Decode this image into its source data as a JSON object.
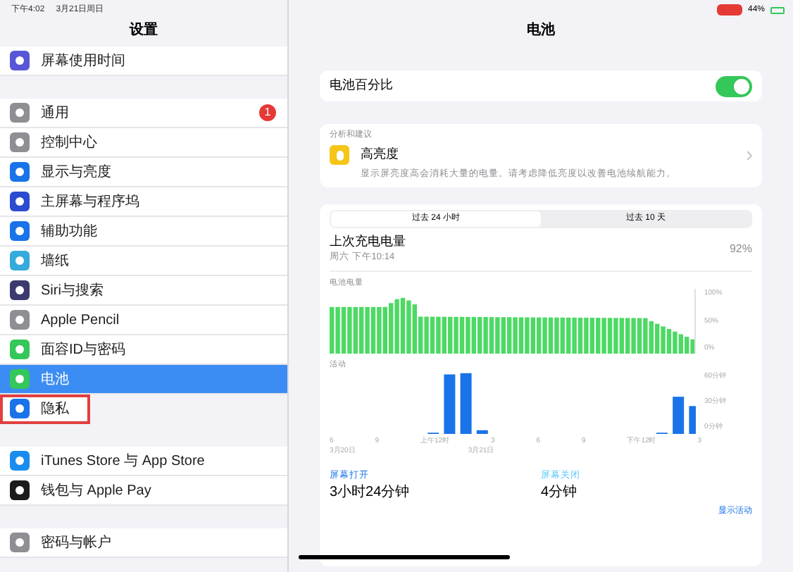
{
  "status_bar": {
    "time": "下午4:02",
    "date": "3月21日周日",
    "battery": "44%"
  },
  "sidebar": {
    "title": "设置",
    "groups": [
      [
        {
          "label": "屏幕使用时间",
          "color": "#5856d6",
          "selected": false,
          "highlighted": false
        }
      ],
      [
        {
          "label": "通用",
          "color": "#8e8e93",
          "selected": false,
          "highlighted": false,
          "badge": "1"
        },
        {
          "label": "控制中心",
          "color": "#8e8e93",
          "selected": false,
          "highlighted": false
        },
        {
          "label": "显示与亮度",
          "color": "#1a73e8",
          "selected": false,
          "highlighted": false
        },
        {
          "label": "主屏幕与程序坞",
          "color": "#2c4bd1",
          "selected": false,
          "highlighted": false
        },
        {
          "label": "辅助功能",
          "color": "#1a73e8",
          "selected": false,
          "highlighted": false
        },
        {
          "label": "墙纸",
          "color": "#35aadc",
          "selected": false,
          "highlighted": false
        },
        {
          "label": "Siri与搜索",
          "color": "#3a3a6e",
          "selected": false,
          "highlighted": false
        },
        {
          "label": "Apple Pencil",
          "color": "#8e8e93",
          "selected": false,
          "highlighted": false
        },
        {
          "label": "面容ID与密码",
          "color": "#34c759",
          "selected": false,
          "highlighted": false
        },
        {
          "label": "电池",
          "color": "#34c759",
          "selected": true,
          "highlighted": false
        },
        {
          "label": "隐私",
          "color": "#1a73e8",
          "selected": false,
          "highlighted": true
        }
      ],
      [
        {
          "label": "iTunes Store 与 App Store",
          "color": "#1a8cf0",
          "selected": false,
          "highlighted": false
        },
        {
          "label": "钱包与 Apple Pay",
          "color": "#1c1c1e",
          "selected": false,
          "highlighted": false
        }
      ],
      [
        {
          "label": "密码与帐户",
          "color": "#8e8e93",
          "selected": false,
          "highlighted": false
        }
      ]
    ]
  },
  "detail": {
    "title": "电池",
    "percentage": {
      "label": "电池百分比",
      "on": true
    },
    "insights": {
      "header": "分析和建议",
      "title": "高亮度",
      "description": "显示屏亮度高会消耗大量的电量。请考虑降低亮度以改善电池续航能力。"
    },
    "tabs": [
      {
        "label": "过去 24 小时",
        "selected": true
      },
      {
        "label": "过去 10 天",
        "selected": false
      }
    ],
    "last_charge": {
      "title": "上次充电电量",
      "time": "周六 下午10:14",
      "value": "92%"
    },
    "battery_chart": {
      "label": "电池电量",
      "yticks": [
        "100%",
        "50%",
        "0%"
      ]
    },
    "activity_chart": {
      "label": "活动",
      "yticks": [
        "60分钟",
        "30分钟",
        "0分钟"
      ],
      "xticks": [
        "6",
        "9",
        "上午12时",
        "3",
        "6",
        "9",
        "下午12时",
        "3"
      ],
      "dates": [
        "3月20日",
        "3月21日"
      ]
    },
    "screen_on": {
      "label": "屏幕打开",
      "value": "3小时24分钟"
    },
    "screen_off": {
      "label": "屏幕关闭",
      "value": "4分钟"
    },
    "show_activity": "显示活动"
  }
}
